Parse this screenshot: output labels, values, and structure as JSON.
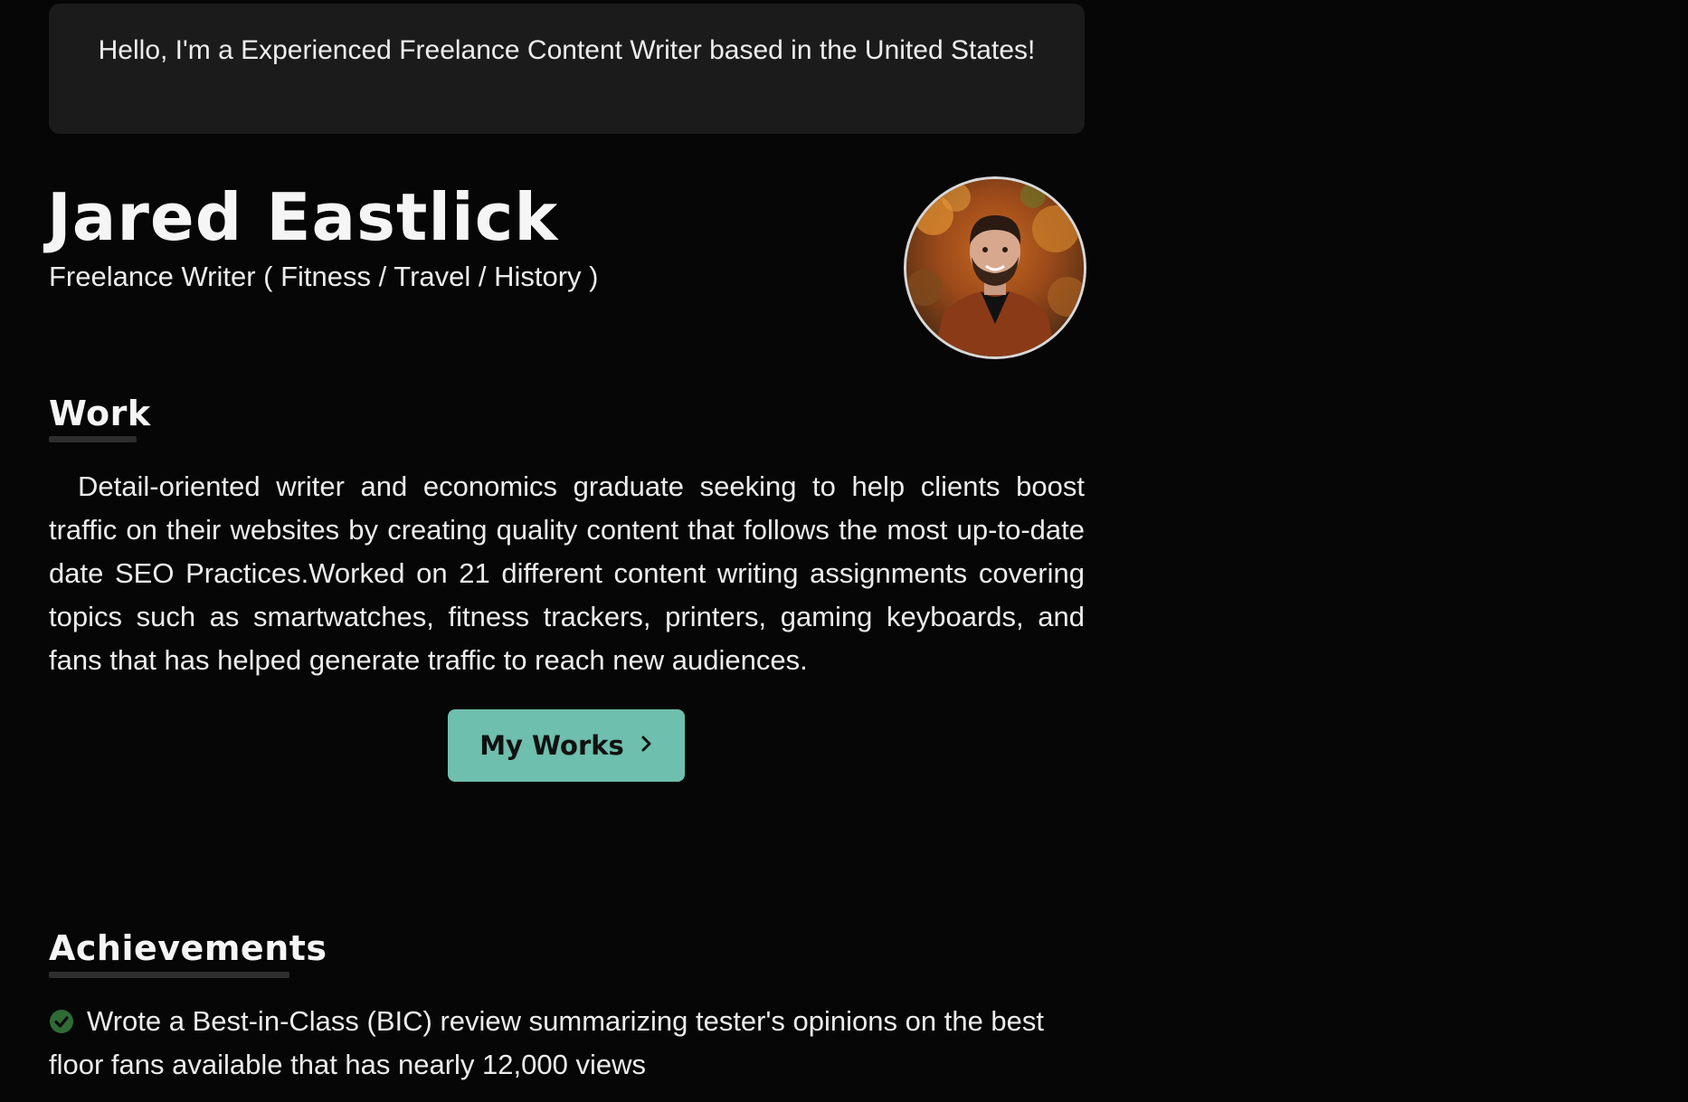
{
  "intro": {
    "text": "Hello, I'm a Experienced Freelance Content Writer based in the United States!"
  },
  "profile": {
    "name": "Jared Eastlick",
    "tagline": "Freelance Writer ( Fitness / Travel / History )",
    "avatar_icon": "profile-photo"
  },
  "work": {
    "heading": "Work",
    "description": "Detail-oriented writer and economics graduate seeking to help clients boost traffic on their websites by creating quality content that follows the most up-to-date date SEO Practices.Worked on 21 different content writing assignments covering topics such as smartwatches, fitness trackers, printers, gaming keyboards, and fans that has helped generate traffic to reach new audiences.",
    "button_label": "My Works",
    "button_icon": "chevron-right-icon"
  },
  "achievements": {
    "heading": "Achievements",
    "items": [
      {
        "icon": "check-circle-icon",
        "text": "Wrote a Best-in-Class (BIC) review summarizing tester's opinions on the best floor fans available that has nearly 12,000 views"
      }
    ]
  },
  "colors": {
    "background": "#060606",
    "card": "#1b1b1c",
    "accent": "#6ebfad",
    "check": "#2f6b37"
  }
}
